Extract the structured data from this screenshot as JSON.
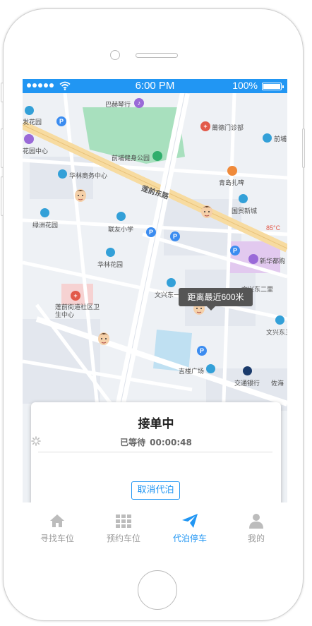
{
  "status_bar": {
    "time": "6:00 PM",
    "battery": "100%"
  },
  "map": {
    "road_name": "莲前东路",
    "labels": [
      {
        "text": "巴赫琴行"
      },
      {
        "text": "莆德门诊部"
      },
      {
        "text": "前埔"
      },
      {
        "text": "发花园"
      },
      {
        "text": "花园中心"
      },
      {
        "text": "前埔健身公园"
      },
      {
        "text": "华林商务中心"
      },
      {
        "text": "青岛扎啤"
      },
      {
        "text": "国贸新城"
      },
      {
        "text": "绿洲花园"
      },
      {
        "text": "联友小学"
      },
      {
        "text": "85°C"
      },
      {
        "text": "华林花园"
      },
      {
        "text": "新华都购"
      },
      {
        "text": "文兴东一里"
      },
      {
        "text": "文兴东二里"
      },
      {
        "text": "莲前街道社区卫生中心"
      },
      {
        "text": "文兴东三"
      },
      {
        "text": "吉楼广场"
      },
      {
        "text": "交通银行"
      },
      {
        "text": "佐海"
      }
    ],
    "tooltip": "距离最近600米"
  },
  "order_card": {
    "title": "接单中",
    "wait_label": "已等待",
    "wait_time": "00:00:48",
    "cancel_label": "取消代泊"
  },
  "tabbar": {
    "items": [
      {
        "label": "寻找车位",
        "icon": "home-icon"
      },
      {
        "label": "预约车位",
        "icon": "grid-icon"
      },
      {
        "label": "代泊停车",
        "icon": "paper-plane-icon",
        "active": true
      },
      {
        "label": "我的",
        "icon": "user-icon"
      }
    ]
  },
  "colors": {
    "accent": "#2196f3",
    "inactive": "#9a9a9a"
  }
}
